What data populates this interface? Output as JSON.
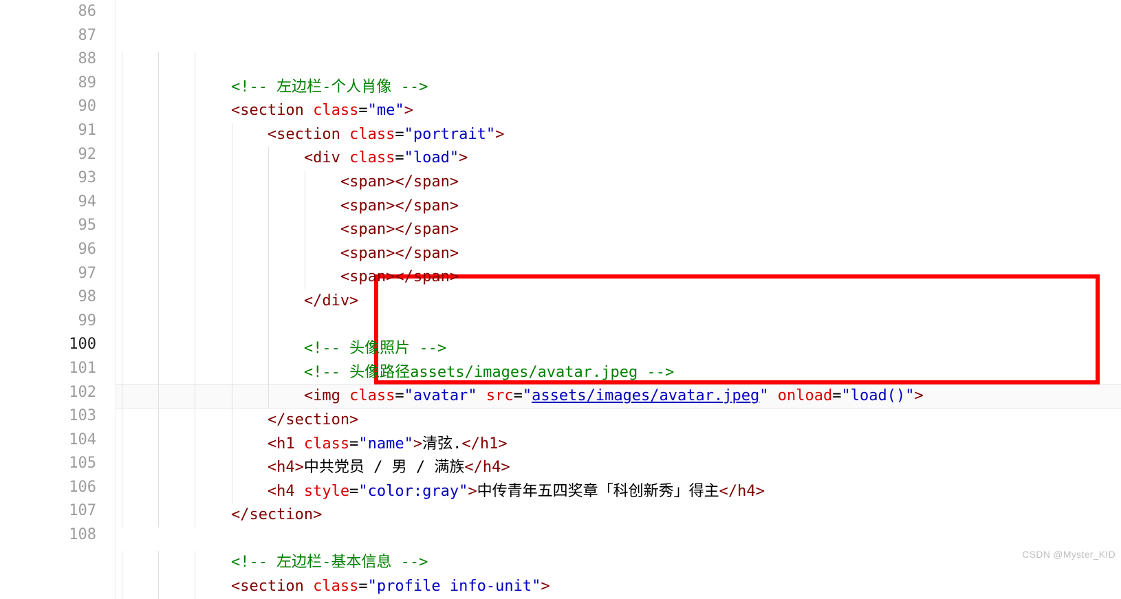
{
  "editor": {
    "current_line_index": 14,
    "lines": [
      {
        "num": "86",
        "tokens": []
      },
      {
        "num": "87",
        "tokens": [
          {
            "cls": "c-comment",
            "t": "<!-- 左边栏-个人肖像 -->"
          }
        ]
      },
      {
        "num": "88",
        "tokens": [
          {
            "cls": "c-bracket",
            "t": "<"
          },
          {
            "cls": "c-tag",
            "t": "section"
          },
          {
            "cls": "",
            "t": " "
          },
          {
            "cls": "c-attr",
            "t": "class"
          },
          {
            "cls": "c-punct",
            "t": "="
          },
          {
            "cls": "c-string",
            "t": "\"me\""
          },
          {
            "cls": "c-bracket",
            "t": ">"
          }
        ]
      },
      {
        "num": "89",
        "tokens": [
          {
            "cls": "c-bracket",
            "t": "<"
          },
          {
            "cls": "c-tag",
            "t": "section"
          },
          {
            "cls": "",
            "t": " "
          },
          {
            "cls": "c-attr",
            "t": "class"
          },
          {
            "cls": "c-punct",
            "t": "="
          },
          {
            "cls": "c-string",
            "t": "\"portrait\""
          },
          {
            "cls": "c-bracket",
            "t": ">"
          }
        ]
      },
      {
        "num": "90",
        "tokens": [
          {
            "cls": "c-bracket",
            "t": "<"
          },
          {
            "cls": "c-tag",
            "t": "div"
          },
          {
            "cls": "",
            "t": " "
          },
          {
            "cls": "c-attr",
            "t": "class"
          },
          {
            "cls": "c-punct",
            "t": "="
          },
          {
            "cls": "c-string",
            "t": "\"load\""
          },
          {
            "cls": "c-bracket",
            "t": ">"
          }
        ]
      },
      {
        "num": "91",
        "tokens": [
          {
            "cls": "c-bracket",
            "t": "<"
          },
          {
            "cls": "c-tag",
            "t": "span"
          },
          {
            "cls": "c-bracket",
            "t": ">"
          },
          {
            "cls": "c-bracket",
            "t": "</"
          },
          {
            "cls": "c-tag",
            "t": "span"
          },
          {
            "cls": "c-bracket",
            "t": ">"
          }
        ]
      },
      {
        "num": "92",
        "tokens": [
          {
            "cls": "c-bracket",
            "t": "<"
          },
          {
            "cls": "c-tag",
            "t": "span"
          },
          {
            "cls": "c-bracket",
            "t": ">"
          },
          {
            "cls": "c-bracket",
            "t": "</"
          },
          {
            "cls": "c-tag",
            "t": "span"
          },
          {
            "cls": "c-bracket",
            "t": ">"
          }
        ]
      },
      {
        "num": "93",
        "tokens": [
          {
            "cls": "c-bracket",
            "t": "<"
          },
          {
            "cls": "c-tag",
            "t": "span"
          },
          {
            "cls": "c-bracket",
            "t": ">"
          },
          {
            "cls": "c-bracket",
            "t": "</"
          },
          {
            "cls": "c-tag",
            "t": "span"
          },
          {
            "cls": "c-bracket",
            "t": ">"
          }
        ]
      },
      {
        "num": "94",
        "tokens": [
          {
            "cls": "c-bracket",
            "t": "<"
          },
          {
            "cls": "c-tag",
            "t": "span"
          },
          {
            "cls": "c-bracket",
            "t": ">"
          },
          {
            "cls": "c-bracket",
            "t": "</"
          },
          {
            "cls": "c-tag",
            "t": "span"
          },
          {
            "cls": "c-bracket",
            "t": ">"
          }
        ]
      },
      {
        "num": "95",
        "tokens": [
          {
            "cls": "c-bracket",
            "t": "<"
          },
          {
            "cls": "c-tag",
            "t": "span"
          },
          {
            "cls": "c-bracket",
            "t": ">"
          },
          {
            "cls": "c-bracket",
            "t": "</"
          },
          {
            "cls": "c-tag",
            "t": "span"
          },
          {
            "cls": "c-bracket",
            "t": ">"
          }
        ]
      },
      {
        "num": "96",
        "tokens": [
          {
            "cls": "c-bracket",
            "t": "</"
          },
          {
            "cls": "c-tag",
            "t": "div"
          },
          {
            "cls": "c-bracket",
            "t": ">"
          }
        ]
      },
      {
        "num": "97",
        "tokens": []
      },
      {
        "num": "98",
        "tokens": [
          {
            "cls": "c-comment",
            "t": "<!-- 头像照片 -->"
          }
        ]
      },
      {
        "num": "99",
        "tokens": [
          {
            "cls": "c-comment",
            "t": "<!-- 头像路径assets/images/avatar.jpeg -->"
          }
        ]
      },
      {
        "num": "100",
        "tokens": [
          {
            "cls": "c-bracket",
            "t": "<"
          },
          {
            "cls": "c-tag",
            "t": "img"
          },
          {
            "cls": "",
            "t": " "
          },
          {
            "cls": "c-attr",
            "t": "class"
          },
          {
            "cls": "c-punct",
            "t": "="
          },
          {
            "cls": "c-string",
            "t": "\"avatar\""
          },
          {
            "cls": "",
            "t": " "
          },
          {
            "cls": "c-attr",
            "t": "src"
          },
          {
            "cls": "c-punct",
            "t": "="
          },
          {
            "cls": "c-string",
            "t": "\""
          },
          {
            "cls": "c-link",
            "t": "assets/images/avatar.jpeg"
          },
          {
            "cls": "c-string",
            "t": "\""
          },
          {
            "cls": "",
            "t": " "
          },
          {
            "cls": "c-attr",
            "t": "onload"
          },
          {
            "cls": "c-punct",
            "t": "="
          },
          {
            "cls": "c-string",
            "t": "\"load()\""
          },
          {
            "cls": "c-bracket",
            "t": ">"
          }
        ]
      },
      {
        "num": "101",
        "tokens": [
          {
            "cls": "c-bracket",
            "t": "</"
          },
          {
            "cls": "c-tag",
            "t": "section"
          },
          {
            "cls": "c-bracket",
            "t": ">"
          }
        ]
      },
      {
        "num": "102",
        "tokens": [
          {
            "cls": "c-bracket",
            "t": "<"
          },
          {
            "cls": "c-tag",
            "t": "h1"
          },
          {
            "cls": "",
            "t": " "
          },
          {
            "cls": "c-attr",
            "t": "class"
          },
          {
            "cls": "c-punct",
            "t": "="
          },
          {
            "cls": "c-string",
            "t": "\"name\""
          },
          {
            "cls": "c-bracket",
            "t": ">"
          },
          {
            "cls": "c-text",
            "t": "清弦."
          },
          {
            "cls": "c-bracket",
            "t": "</"
          },
          {
            "cls": "c-tag",
            "t": "h1"
          },
          {
            "cls": "c-bracket",
            "t": ">"
          }
        ]
      },
      {
        "num": "103",
        "tokens": [
          {
            "cls": "c-bracket",
            "t": "<"
          },
          {
            "cls": "c-tag",
            "t": "h4"
          },
          {
            "cls": "c-bracket",
            "t": ">"
          },
          {
            "cls": "c-text",
            "t": "中共党员 / 男 / 满族"
          },
          {
            "cls": "c-bracket",
            "t": "</"
          },
          {
            "cls": "c-tag",
            "t": "h4"
          },
          {
            "cls": "c-bracket",
            "t": ">"
          }
        ]
      },
      {
        "num": "104",
        "tokens": [
          {
            "cls": "c-bracket",
            "t": "<"
          },
          {
            "cls": "c-tag",
            "t": "h4"
          },
          {
            "cls": "",
            "t": " "
          },
          {
            "cls": "c-attr",
            "t": "style"
          },
          {
            "cls": "c-punct",
            "t": "="
          },
          {
            "cls": "c-string",
            "t": "\"color:gray\""
          },
          {
            "cls": "c-bracket",
            "t": ">"
          },
          {
            "cls": "c-text",
            "t": "中传青年五四奖章「科创新秀」得主"
          },
          {
            "cls": "c-bracket",
            "t": "</"
          },
          {
            "cls": "c-tag",
            "t": "h4"
          },
          {
            "cls": "c-bracket",
            "t": ">"
          }
        ]
      },
      {
        "num": "105",
        "tokens": [
          {
            "cls": "c-bracket",
            "t": "</"
          },
          {
            "cls": "c-tag",
            "t": "section"
          },
          {
            "cls": "c-bracket",
            "t": ">"
          }
        ]
      },
      {
        "num": "106",
        "tokens": []
      },
      {
        "num": "107",
        "tokens": [
          {
            "cls": "c-comment",
            "t": "<!-- 左边栏-基本信息 -->"
          }
        ]
      },
      {
        "num": "108",
        "tokens": [
          {
            "cls": "c-bracket",
            "t": "<"
          },
          {
            "cls": "c-tag",
            "t": "section"
          },
          {
            "cls": "",
            "t": " "
          },
          {
            "cls": "c-attr",
            "t": "class"
          },
          {
            "cls": "c-punct",
            "t": "="
          },
          {
            "cls": "c-string",
            "t": "\"profile info-unit\""
          },
          {
            "cls": "c-bracket",
            "t": ">"
          }
        ]
      }
    ],
    "indent_levels": [
      3,
      3,
      3,
      4,
      5,
      6,
      6,
      6,
      6,
      6,
      5,
      5,
      5,
      5,
      5,
      4,
      4,
      4,
      4,
      3,
      3,
      3,
      3
    ],
    "indent_guides": [
      3,
      3,
      3,
      4,
      5,
      6,
      6,
      6,
      6,
      6,
      5,
      5,
      5,
      5,
      5,
      4,
      4,
      4,
      4,
      3,
      0,
      3,
      3
    ]
  },
  "watermark": "CSDN @Myster_KID"
}
